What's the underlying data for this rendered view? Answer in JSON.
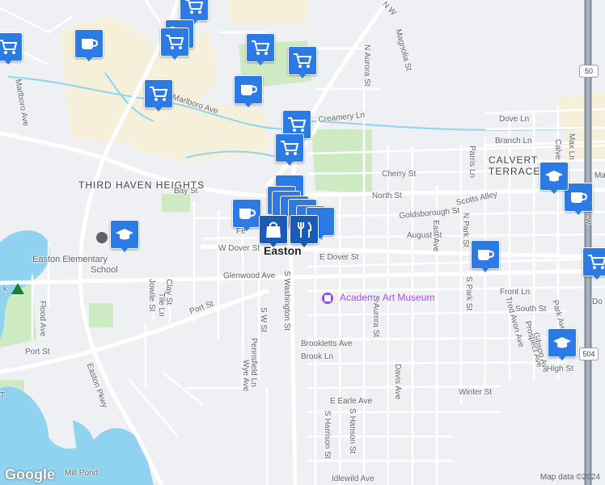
{
  "map": {
    "colors": {
      "background": "#eef0f3",
      "water": "#8fd3f0",
      "park": "#cdeac2",
      "urban": "#f6efd9",
      "road": "#ffffff",
      "highway": "#7b8794",
      "pin": "#2c7be5",
      "pin_dark": "#1a5bb8"
    },
    "places": {
      "third_haven_heights": "THIRD HAVEN HEIGHTS",
      "calvert_terrace_1": "CALVERT",
      "calvert_terrace_2": "TERRACE",
      "easton": "Easton",
      "academy_art_museum": "Academy Art Museum",
      "easton_elementary_1": "Easton Elementary",
      "easton_elementary_2": "School"
    },
    "streets": {
      "bay_st": "Bay St",
      "north_st": "North St",
      "scotts_alley": "Scotts Alley",
      "goldsborough_st": "Goldsborough St",
      "august_st": "August St",
      "cherry_st": "Cherry St",
      "creamery_ln": "Creamery Ln",
      "dove_ln": "Dove Ln",
      "branch_ln": "Branch Ln",
      "w_dover_st": "W Dover St",
      "e_dover_st": "E Dover St",
      "glenwood_ave": "Glenwood Ave",
      "port_st": "Port St",
      "port_st_2": "Port St",
      "brookletts_ave": "Brookletts Ave",
      "brook_ln": "Brook Ln",
      "e_earle_ave": "E Earle Ave",
      "idlewild_ave": "Idlewild Ave",
      "winter_st": "Winter St",
      "front_ln": "Front Ln",
      "south_st": "South St",
      "high_st": "High St",
      "marlboro_ave": "Marlboro Ave",
      "marlboro_ave_2": "Marlboro Ave",
      "n_aurora_st": "N Aurora St",
      "magnolia_st": "Magnolia St",
      "s_aurora_st": "S Aurora St",
      "s_washington_st": "S Washington St",
      "s_w_st": "S W St",
      "pennsfield_ln": "Pennsfield Ln",
      "wye_ave": "Wye Ave",
      "clay_st": "Clay St",
      "tile_ln": "Tile Ln",
      "jowite_st": "Jowite St",
      "flood_ave": "Flood Ave",
      "easton_pkwy": "Easton Pkwy",
      "davis_ave": "Davis Ave",
      "s_hanson_st": "S Hanson St",
      "s_harrison_st": "S Harrison St",
      "east_ave": "East Ave",
      "s_park_st": "S Park St",
      "n_park_st": "N Park St",
      "parris_ln": "Parris Ln",
      "tred_avon_ave": "Tred Avon Ave",
      "prospect_ave": "Prospect Ave",
      "gibson_ave": "Gibson Ave",
      "park_ave": "Park Ave",
      "calvert_st": "Calve",
      "max_ln": "Max Ln",
      "n_washington_st": "N W",
      "doug": "Do",
      "goldsborough_cut": "Fe",
      "harris_pl": "ll Pl",
      "ma": "Ma",
      "gatew": "n Gatew",
      "mill_pond": "Mill Pond",
      "t_label": "T",
      "k": "k",
      "t_label2": "t"
    },
    "shields": {
      "us50_a": "50",
      "us50_b": "50",
      "md504": "504"
    },
    "attribution": "Map data ©2024",
    "logo": "Google",
    "pins": [
      {
        "kind": "grocery",
        "icon": "cart-icon"
      },
      {
        "kind": "grocery",
        "icon": "cart-icon"
      },
      {
        "kind": "grocery",
        "icon": "cart-icon"
      },
      {
        "kind": "grocery",
        "icon": "cart-icon"
      },
      {
        "kind": "grocery",
        "icon": "cart-icon"
      },
      {
        "kind": "grocery",
        "icon": "cart-icon"
      },
      {
        "kind": "grocery",
        "icon": "cart-icon"
      },
      {
        "kind": "grocery",
        "icon": "cart-icon"
      },
      {
        "kind": "grocery",
        "icon": "cart-icon"
      },
      {
        "kind": "cafe",
        "icon": "coffee-cup-icon"
      },
      {
        "kind": "cafe",
        "icon": "coffee-cup-icon"
      },
      {
        "kind": "cafe",
        "icon": "coffee-cup-icon"
      },
      {
        "kind": "cafe",
        "icon": "coffee-cup-icon"
      },
      {
        "kind": "cafe",
        "icon": "coffee-cup-icon"
      },
      {
        "kind": "school",
        "icon": "graduation-cap-icon"
      },
      {
        "kind": "school",
        "icon": "graduation-cap-icon"
      },
      {
        "kind": "school",
        "icon": "graduation-cap-icon"
      },
      {
        "kind": "shopping",
        "icon": "shopping-bag-icon"
      },
      {
        "kind": "restaurant",
        "icon": "fork-knife-icon"
      }
    ]
  }
}
